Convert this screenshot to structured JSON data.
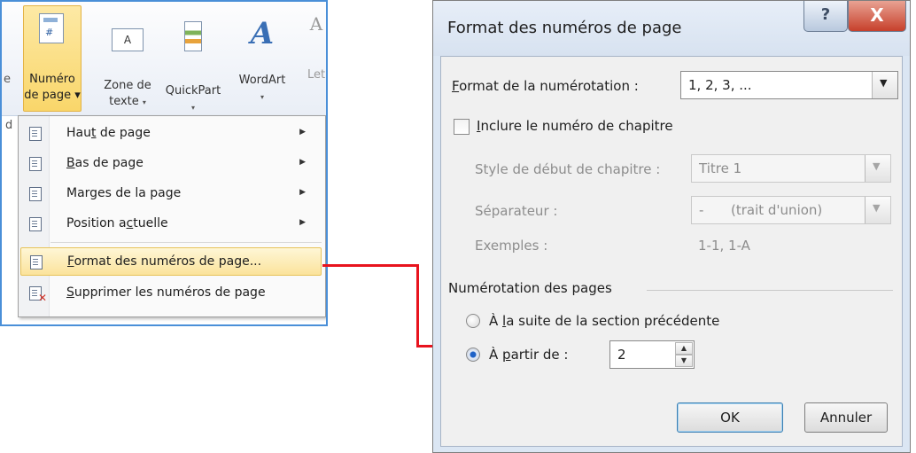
{
  "ribbon": {
    "page_number": {
      "line1": "Numéro",
      "line2": "de page",
      "dropdown": "▾"
    },
    "text_box": {
      "line1": "Zone de",
      "line2": "texte",
      "dropdown": "▾"
    },
    "quickpart": {
      "label": "QuickPart",
      "dropdown": "▾"
    },
    "wordart": {
      "label": "WordArt",
      "dropdown": "▾"
    },
    "lettrine_cut": "Let",
    "left_cut_labels": [
      "e",
      "d"
    ]
  },
  "menu": {
    "items": [
      {
        "pre": "Hau",
        "key": "t",
        "post": " de page",
        "arrow": "▶"
      },
      {
        "pre": "",
        "key": "B",
        "post": "as de page",
        "arrow": "▶"
      },
      {
        "pre": "Marges de la page",
        "key": "",
        "post": "",
        "arrow": "▶"
      },
      {
        "pre": "Position a",
        "key": "c",
        "post": "tuelle",
        "arrow": "▶"
      },
      {
        "pre": "",
        "key": "F",
        "post": "ormat des numéros de page...",
        "arrow": ""
      },
      {
        "pre": "",
        "key": "S",
        "post": "upprimer les numéros de page",
        "arrow": ""
      }
    ]
  },
  "dialog": {
    "title": "Format des numéros de page",
    "help": "?",
    "close": "X",
    "format_label_key": "F",
    "format_label_rest": "ormat de la numérotation :",
    "format_value": "1, 2, 3, ...",
    "include_chapter_key": "I",
    "include_chapter_rest": "nclure le numéro de chapitre",
    "chapter_style_label": "Style de début de chapitre :",
    "chapter_style_value": "Titre 1",
    "separator_label": "Séparateur :",
    "separator_value": "-",
    "separator_desc": "(trait d'union)",
    "examples_label": "Exemples :",
    "examples_value": "1-1, 1-A",
    "numbering_group": "Numérotation des pages",
    "continue_pre": "À ",
    "continue_key": "l",
    "continue_post": "a suite de la section précédente",
    "start_at_pre": "À ",
    "start_at_key": "p",
    "start_at_post": "artir de :",
    "start_at_value": "2",
    "ok": "OK",
    "cancel": "Annuler"
  },
  "colors": {
    "arrow": "#e8131e",
    "highlight": "#fbe39b",
    "accent_border": "#4a8fd8"
  }
}
